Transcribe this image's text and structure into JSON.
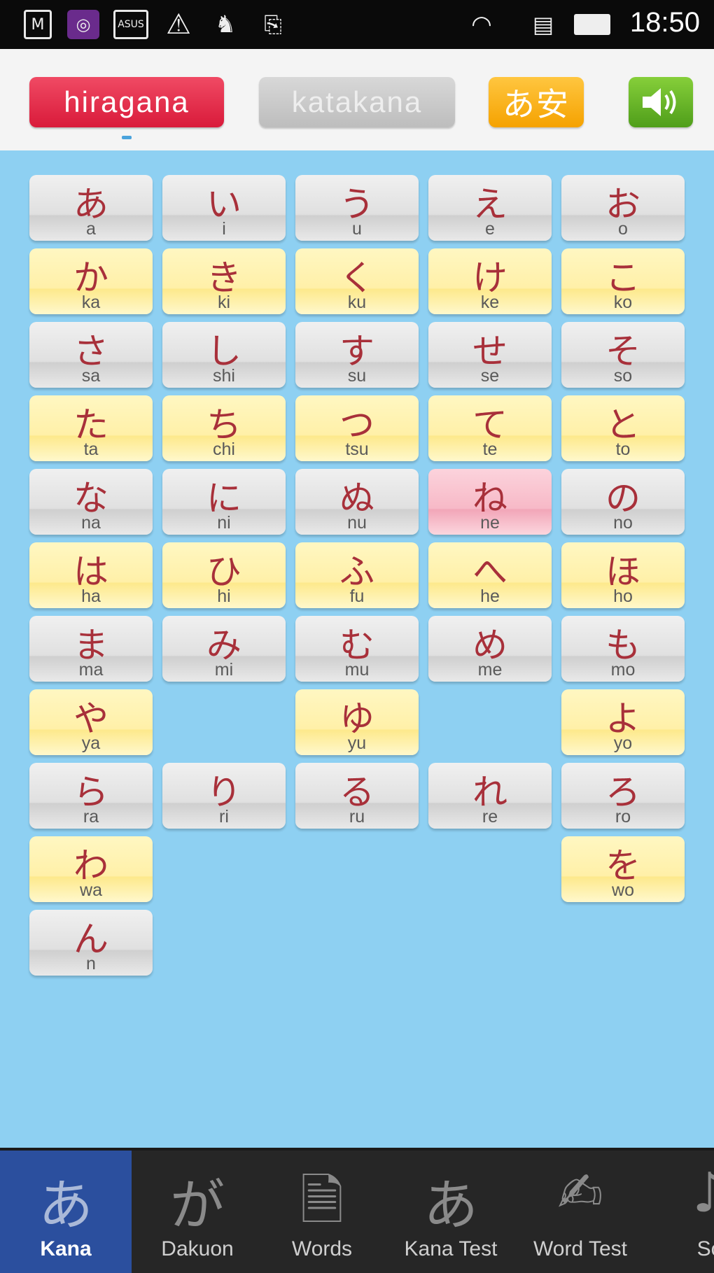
{
  "status_bar": {
    "time": "18:50",
    "icons": [
      "gmail-icon",
      "app-icon",
      "asus-icon",
      "warning-icon",
      "cat-icon",
      "share-icon",
      "wifi-icon",
      "sim-icon",
      "battery-icon"
    ]
  },
  "toolbar": {
    "hiragana_label": "hiragana",
    "katakana_label": "katakana",
    "kanji_label": "あ安",
    "sound_icon": "speaker-icon",
    "colors": {
      "hiragana": "#e32447",
      "katakana": "#c8c8c8",
      "kanji": "#f8b41a",
      "sound": "#66b52a"
    }
  },
  "kana_rows": [
    [
      {
        "k": "あ",
        "r": "a"
      },
      {
        "k": "い",
        "r": "i"
      },
      {
        "k": "う",
        "r": "u"
      },
      {
        "k": "え",
        "r": "e"
      },
      {
        "k": "お",
        "r": "o"
      }
    ],
    [
      {
        "k": "か",
        "r": "ka"
      },
      {
        "k": "き",
        "r": "ki"
      },
      {
        "k": "く",
        "r": "ku"
      },
      {
        "k": "け",
        "r": "ke"
      },
      {
        "k": "こ",
        "r": "ko"
      }
    ],
    [
      {
        "k": "さ",
        "r": "sa"
      },
      {
        "k": "し",
        "r": "shi"
      },
      {
        "k": "す",
        "r": "su"
      },
      {
        "k": "せ",
        "r": "se"
      },
      {
        "k": "そ",
        "r": "so"
      }
    ],
    [
      {
        "k": "た",
        "r": "ta"
      },
      {
        "k": "ち",
        "r": "chi"
      },
      {
        "k": "つ",
        "r": "tsu"
      },
      {
        "k": "て",
        "r": "te"
      },
      {
        "k": "と",
        "r": "to"
      }
    ],
    [
      {
        "k": "な",
        "r": "na"
      },
      {
        "k": "に",
        "r": "ni"
      },
      {
        "k": "ぬ",
        "r": "nu"
      },
      {
        "k": "ね",
        "r": "ne",
        "selected": true
      },
      {
        "k": "の",
        "r": "no"
      }
    ],
    [
      {
        "k": "は",
        "r": "ha"
      },
      {
        "k": "ひ",
        "r": "hi"
      },
      {
        "k": "ふ",
        "r": "fu"
      },
      {
        "k": "へ",
        "r": "he"
      },
      {
        "k": "ほ",
        "r": "ho"
      }
    ],
    [
      {
        "k": "ま",
        "r": "ma"
      },
      {
        "k": "み",
        "r": "mi"
      },
      {
        "k": "む",
        "r": "mu"
      },
      {
        "k": "め",
        "r": "me"
      },
      {
        "k": "も",
        "r": "mo"
      }
    ],
    [
      {
        "k": "や",
        "r": "ya"
      },
      null,
      {
        "k": "ゆ",
        "r": "yu"
      },
      null,
      {
        "k": "よ",
        "r": "yo"
      }
    ],
    [
      {
        "k": "ら",
        "r": "ra"
      },
      {
        "k": "り",
        "r": "ri"
      },
      {
        "k": "る",
        "r": "ru"
      },
      {
        "k": "れ",
        "r": "re"
      },
      {
        "k": "ろ",
        "r": "ro"
      }
    ],
    [
      {
        "k": "わ",
        "r": "wa"
      },
      null,
      null,
      null,
      {
        "k": "を",
        "r": "wo"
      }
    ],
    [
      {
        "k": "ん",
        "r": "n"
      },
      null,
      null,
      null,
      null
    ]
  ],
  "bottom_nav": [
    {
      "icon": "あ",
      "icon_name": "kana-icon",
      "label": "Kana",
      "active": true
    },
    {
      "icon": "が",
      "icon_name": "dakuon-icon",
      "label": "Dakuon"
    },
    {
      "icon": "🗎",
      "icon_name": "document-icon",
      "label": "Words"
    },
    {
      "icon": "あ",
      "icon_name": "kana-test-icon",
      "label": "Kana Test"
    },
    {
      "icon": "✍",
      "icon_name": "word-test-icon",
      "label": "Word Test"
    },
    {
      "icon": "♪",
      "icon_name": "music-note-icon",
      "label": "So"
    }
  ]
}
